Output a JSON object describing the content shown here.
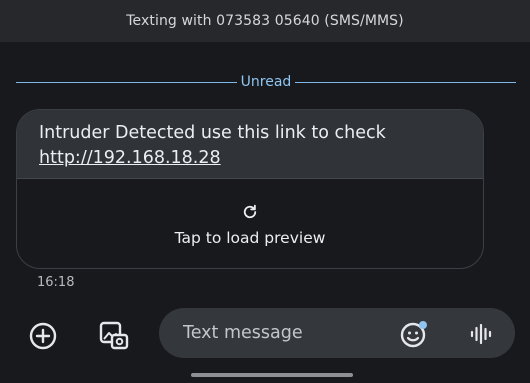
{
  "header": {
    "title": "Texting with 073583 05640 (SMS/MMS)"
  },
  "divider": {
    "label": "Unread"
  },
  "message": {
    "text": "Intruder Detected use this link to check",
    "link": "http://192.168.18.28",
    "preview_label": "Tap to load preview",
    "time": "16:18"
  },
  "composer": {
    "placeholder": "Text message"
  },
  "icons": {
    "add": "plus-circle-icon",
    "gallery": "gallery-icon",
    "emoji": "emoji-icon",
    "voice": "voice-waveform-icon",
    "refresh": "refresh-icon"
  },
  "colors": {
    "background": "#17191d",
    "accent": "#8fc5f0",
    "bubble": "#303338"
  }
}
